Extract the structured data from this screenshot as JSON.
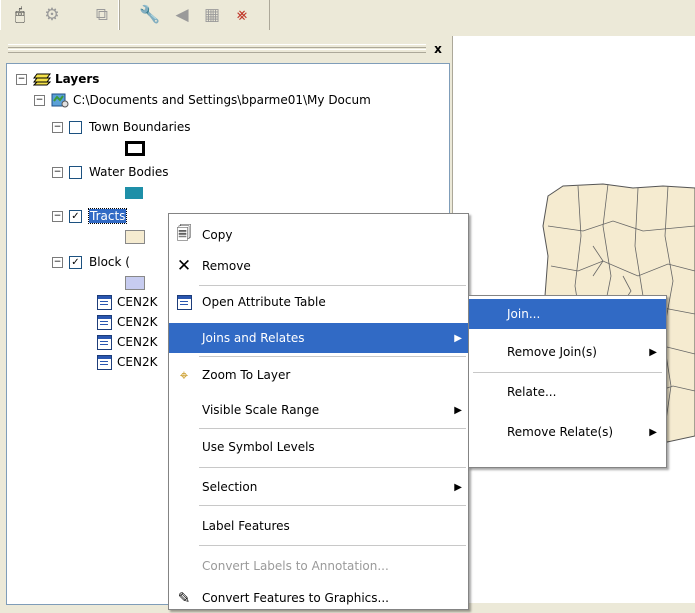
{
  "toolbar": {
    "buttons": [
      "identify-tool",
      "hyperlink-tool",
      "measure-tool",
      "editor-tool",
      "route-tool",
      "time-slider",
      "graph-tool"
    ]
  },
  "toc": {
    "close_glyph": "x",
    "root_label": "Layers",
    "data_frame_path": "C:\\Documents and Settings\\bparme01\\My Docum",
    "layers": [
      {
        "label": "Town Boundaries",
        "checked": false
      },
      {
        "label": "Water Bodies",
        "checked": false
      },
      {
        "label": "Tracts",
        "checked": true,
        "selected": true
      },
      {
        "label": "Block (",
        "checked": true
      }
    ],
    "tables": [
      "CEN2K",
      "CEN2K",
      "CEN2K",
      "CEN2K"
    ]
  },
  "context_menu": {
    "items": [
      {
        "label": "Copy",
        "icon": "copy-icon",
        "mnemonic": "C"
      },
      {
        "label": "Remove",
        "icon": "remove-icon",
        "mnemonic": "R"
      },
      {
        "label": "Open Attribute Table",
        "icon": "attribute-table-icon",
        "mnemonic": "T"
      },
      {
        "label": "Joins and Relates",
        "highlighted": true,
        "submenu": true,
        "mnemonic": "J"
      },
      {
        "label": "Zoom To Layer",
        "icon": "zoom-to-layer-icon",
        "mnemonic": "Z"
      },
      {
        "label": "Visible Scale Range",
        "submenu": true,
        "mnemonic": "V"
      },
      {
        "label": "Use Symbol Levels",
        "mnemonic": "e"
      },
      {
        "label": "Selection",
        "submenu": true,
        "mnemonic": "S"
      },
      {
        "label": "Label Features",
        "mnemonic": "L"
      },
      {
        "label": "Convert Labels to Annotation...",
        "disabled": true,
        "mnemonic": "n"
      },
      {
        "label": "Convert Features to Graphics...",
        "icon": "convert-graphics-icon",
        "mnemonic": "v"
      }
    ]
  },
  "submenu": {
    "items": [
      {
        "label": "Join...",
        "highlighted": true
      },
      {
        "label": "Remove Join(s)",
        "submenu": true
      },
      {
        "label": "Relate..."
      },
      {
        "label": "Remove Relate(s)",
        "submenu": true
      }
    ]
  },
  "colors": {
    "selection": "#316AC5",
    "window_bg": "#ECE9D8",
    "tracts_fill": "#F5EBD0",
    "water_fill": "#1E8FA8",
    "block_fill": "#C7CCF0"
  }
}
